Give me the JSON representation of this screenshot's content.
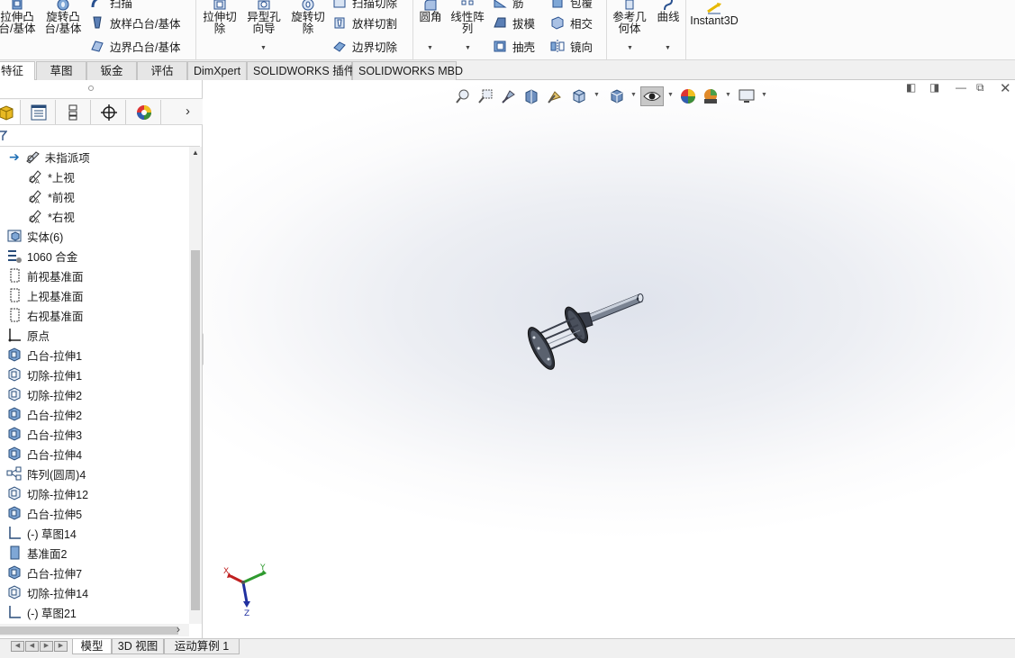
{
  "ribbon": {
    "extrude_boss": "拉伸凸\n台/基体",
    "revolve_boss": "旋转凸\n台/基体",
    "sweep": "扫描",
    "loft_boss": "放样凸台/基体",
    "boundary_boss": "边界凸台/基体",
    "extrude_cut": "拉伸切\n除",
    "hole_wizard": "异型孔\n向导",
    "revolve_cut": "旋转切\n除",
    "sweep_cut": "扫描切除",
    "loft_cut": "放样切割",
    "boundary_cut": "边界切除",
    "fillet": "圆角",
    "linear_pattern": "线性阵\n列",
    "rib": "筋",
    "draft": "拔模",
    "shell": "抽壳",
    "wrap": "包覆",
    "intersect": "相交",
    "mirror": "镜向",
    "ref_geometry": "参考几\n何体",
    "curves": "曲线",
    "instant3d": "Instant3D"
  },
  "cm_tabs": [
    "特征",
    "草图",
    "钣金",
    "评估",
    "DimXpert",
    "SOLIDWORKS 插件",
    "SOLIDWORKS MBD"
  ],
  "tree": [
    {
      "label": "未指派项",
      "icon": "unassigned-icon"
    },
    {
      "label": "*上视",
      "icon": "view-orientation-icon"
    },
    {
      "label": "*前视",
      "icon": "view-orientation-icon"
    },
    {
      "label": "*右视",
      "icon": "view-orientation-icon"
    },
    {
      "label": "实体(6)",
      "icon": "solid-bodies-icon"
    },
    {
      "label": "1060 合金",
      "icon": "material-icon"
    },
    {
      "label": "前视基准面",
      "icon": "plane-icon"
    },
    {
      "label": "上视基准面",
      "icon": "plane-icon"
    },
    {
      "label": "右视基准面",
      "icon": "plane-icon"
    },
    {
      "label": "原点",
      "icon": "origin-icon"
    },
    {
      "label": "凸台-拉伸1",
      "icon": "boss-extrude-icon"
    },
    {
      "label": "切除-拉伸1",
      "icon": "cut-extrude-icon"
    },
    {
      "label": "切除-拉伸2",
      "icon": "cut-extrude-icon"
    },
    {
      "label": "凸台-拉伸2",
      "icon": "boss-extrude-icon"
    },
    {
      "label": "凸台-拉伸3",
      "icon": "boss-extrude-icon"
    },
    {
      "label": "凸台-拉伸4",
      "icon": "boss-extrude-icon"
    },
    {
      "label": "阵列(圆周)4",
      "icon": "circular-pattern-icon"
    },
    {
      "label": "切除-拉伸12",
      "icon": "cut-extrude-icon"
    },
    {
      "label": "凸台-拉伸5",
      "icon": "boss-extrude-icon"
    },
    {
      "label": "(-) 草图14",
      "icon": "sketch-icon"
    },
    {
      "label": "基准面2",
      "icon": "plane2-icon"
    },
    {
      "label": "凸台-拉伸7",
      "icon": "boss-extrude-icon"
    },
    {
      "label": "切除-拉伸14",
      "icon": "cut-extrude-icon"
    },
    {
      "label": "(-) 草图21",
      "icon": "sketch-icon"
    }
  ],
  "triad": {
    "x": "X",
    "y": "Y",
    "z": "Z"
  },
  "bottom_tabs": [
    "模型",
    "3D 视图",
    "运动算例 1"
  ],
  "colors": {
    "accent_blue": "#1f6fb5",
    "brand_yellow": "#e6b800"
  }
}
